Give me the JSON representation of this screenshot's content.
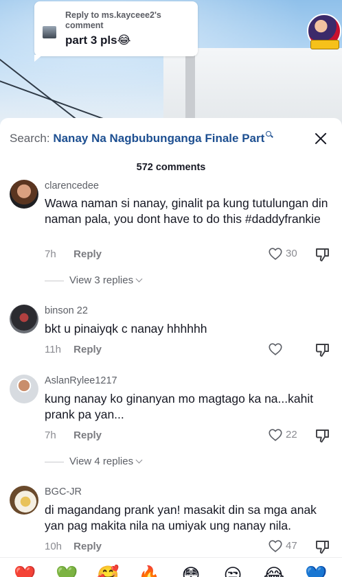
{
  "reply_card": {
    "heading": "Reply to ms.kayceee2's comment",
    "text": "part 3 pls😂"
  },
  "search": {
    "prefix": "Search:",
    "term": "Nanay Na Nagbubunganga Finale Part"
  },
  "comment_count": "572 comments",
  "comments": [
    {
      "username": "clarencedee",
      "text": "Wawa naman si nanay, ginalit pa kung tutulungan din naman pala, you dont have to do this #daddyfrankie",
      "time": "7h",
      "reply_label": "Reply",
      "likes": "30",
      "view_replies": "View 3 replies"
    },
    {
      "username": "binson 22",
      "text": "bkt u pinaiyqk c nanay hhhhhh",
      "time": "11h",
      "reply_label": "Reply",
      "likes": ""
    },
    {
      "username": "AslanRylee1217",
      "text": "kung nanay ko ginanyan mo magtago ka na...kahit prank pa yan...",
      "time": "7h",
      "reply_label": "Reply",
      "likes": "22",
      "view_replies": "View 4 replies"
    },
    {
      "username": "BGC-JR",
      "text": "di magandang prank yan! masakit din sa mga anak yan pag makita nila na umiyak ung nanay nila.",
      "time": "10h",
      "reply_label": "Reply",
      "likes": "47"
    }
  ],
  "icons": {
    "like": "heart-outline-icon",
    "dislike": "thumbs-down-icon",
    "close": "close-icon",
    "search": "search-icon"
  },
  "emoji_bar": [
    "❤️",
    "💚",
    "🥰",
    "🔥",
    "😳",
    "😒",
    "😂",
    "💙"
  ],
  "colors": {
    "accent_link": "#1d4f91",
    "text_primary": "#161823",
    "text_secondary": "#8a8b91"
  }
}
